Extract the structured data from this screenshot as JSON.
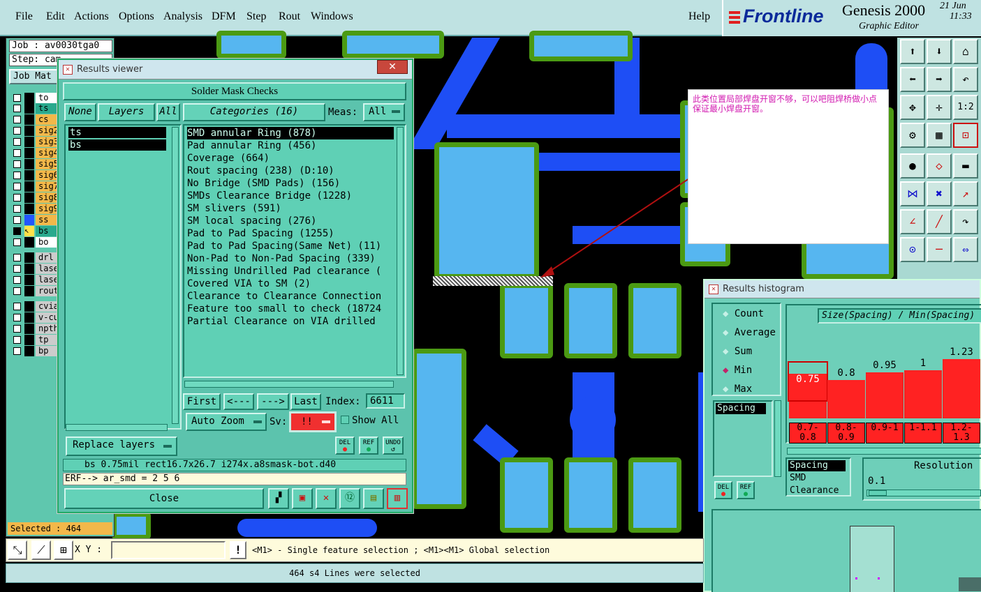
{
  "menu": {
    "items": [
      "File",
      "Edit",
      "Actions",
      "Options",
      "Analysis",
      "DFM",
      "Step",
      "Rout",
      "Windows"
    ],
    "help": "Help"
  },
  "brand": {
    "logo": "Frontline",
    "product": "Genesis 2000",
    "subtitle": "Graphic Editor",
    "date": "21 Jun",
    "time": "11:33"
  },
  "job": {
    "job_line": "Job : av0030tga0",
    "step_line": "Step: cam",
    "matrix_label": "Job Mat",
    "selected": "Selected : 464"
  },
  "layers": [
    {
      "name": "to",
      "color": "#ffffff"
    },
    {
      "name": "ts",
      "color": "#2aa98d"
    },
    {
      "name": "cs",
      "color": "#f2b84a"
    },
    {
      "name": "sig2",
      "color": "#f2b84a"
    },
    {
      "name": "sig3",
      "color": "#f2b84a"
    },
    {
      "name": "sig4",
      "color": "#f2b84a"
    },
    {
      "name": "sig5",
      "color": "#f2b84a"
    },
    {
      "name": "sig6",
      "color": "#f2b84a"
    },
    {
      "name": "sig7",
      "color": "#f2b84a"
    },
    {
      "name": "sig8",
      "color": "#f2b84a"
    },
    {
      "name": "sig9",
      "color": "#f2b84a"
    },
    {
      "name": "ss",
      "color": "#f2b84a"
    },
    {
      "name": "bs",
      "color": "#2aa98d"
    },
    {
      "name": "bo",
      "color": "#ffffff"
    },
    {
      "name": "drl",
      "color": "#cccccc"
    },
    {
      "name": "laser",
      "color": "#cccccc"
    },
    {
      "name": "laser",
      "color": "#cccccc"
    },
    {
      "name": "rout",
      "color": "#cccccc"
    },
    {
      "name": "cvia",
      "color": "#cccccc"
    },
    {
      "name": "v-cut",
      "color": "#cccccc"
    },
    {
      "name": "npth",
      "color": "#cccccc"
    },
    {
      "name": "tp",
      "color": "#cccccc"
    },
    {
      "name": "bp",
      "color": "#cccccc"
    }
  ],
  "results_viewer": {
    "window_title": "Results viewer",
    "header": "Solder Mask Checks",
    "none_btn": "None",
    "layers_btn": "Layers",
    "all_btn": "All",
    "categories_btn": "Categories (16)",
    "meas_label": "Meas:",
    "meas_value": "All",
    "layer_list": [
      "ts",
      "bs"
    ],
    "categories": [
      "SMD annular Ring (878)",
      "Pad annular Ring (456)",
      "Coverage (664)",
      "Rout spacing (238)        (D:10)",
      "No Bridge (SMD Pads) (156)",
      "SMDs Clearance Bridge (1228)",
      "SM slivers (591)",
      "SM local spacing (276)",
      "Pad to Pad Spacing (1255)",
      "Pad to Pad Spacing(Same Net) (11)",
      "Non-Pad to Non-Pad Spacing (339)",
      "Missing Undrilled Pad clearance (",
      "Covered VIA to SM (2)",
      "Clearance to Clearance Connection",
      "Feature too small to check (18724",
      "Partial Clearance on VIA drilled"
    ],
    "first": "First",
    "prev": "<---",
    "next": "--->",
    "last": "Last",
    "index_label": "Index:",
    "index_value": "6611",
    "auto_zoom": "Auto Zoom",
    "sv_label": "Sv:",
    "sv_value": "!!",
    "show_all": "Show All",
    "del": "DEL",
    "ref": "REF",
    "undo": "UNDO",
    "replace_layers": "Replace layers",
    "info_line": "bs 0.75mil  rect16.7x26.7  i274x.a8smask-bot.d40",
    "erf_line": "ERF--> ar_smd = 2 5 6",
    "close": "Close"
  },
  "note": {
    "text": "此类位置局部焊盘开窗不够，可以吧阻焊桥做小点保证最小焊盘开窗。"
  },
  "histogram": {
    "window_title": "Results histogram",
    "modes": [
      "Count",
      "Average",
      "Sum",
      "Min",
      "Max"
    ],
    "selected_mode": "Min",
    "measure_list_sel": "Spacing",
    "title": "Size(Spacing) / Min(Spacing)",
    "del": "DEL",
    "ref": "REF",
    "lower_list": [
      "Spacing",
      "SMD",
      "Clearance"
    ],
    "resolution_label": "Resolution",
    "resolution_value": "0.1"
  },
  "chart_data": {
    "type": "bar",
    "title": "Size(Spacing) / Min(Spacing)",
    "categories": [
      "0.7-0.8",
      "0.8-0.9",
      "0.9-1",
      "1-1.1",
      "1.2-1.3"
    ],
    "values": [
      0.75,
      0.8,
      0.95,
      1,
      1.23
    ],
    "ylim": [
      0,
      1.3
    ]
  },
  "bottom": {
    "xy_label": "X Y :",
    "xy_value": "",
    "hint": "<M1> - Single feature selection ; <M1><M1> Global selection",
    "status": "464 s4 Lines were selected"
  },
  "colors": {
    "panel_teal": "#5fd0b5",
    "trace_blue": "#1e4ef5",
    "pad_fill": "#56b6f0",
    "pad_outline": "#4b9a13",
    "hist_red": "#ff2222"
  }
}
